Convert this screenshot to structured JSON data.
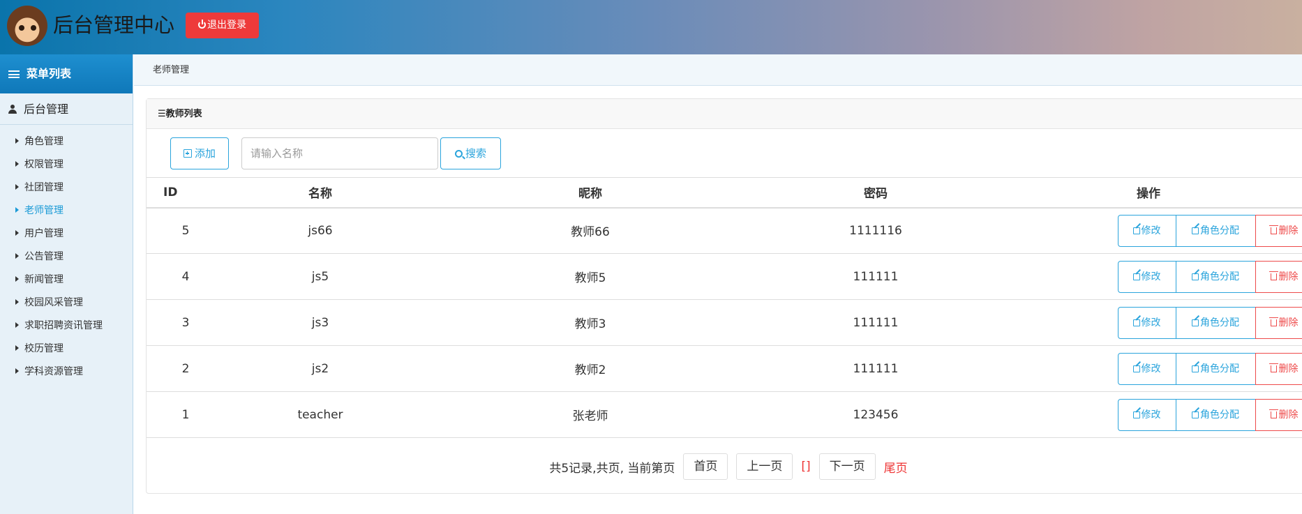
{
  "header": {
    "site_title": "后台管理中心",
    "logout_label": "退出登录",
    "accent_color": "#ee3a3a"
  },
  "sidebar": {
    "menu_title": "菜单列表",
    "group_title": "后台管理",
    "items": [
      {
        "label": "角色管理",
        "active": false
      },
      {
        "label": "权限管理",
        "active": false
      },
      {
        "label": "社团管理",
        "active": false
      },
      {
        "label": "老师管理",
        "active": true
      },
      {
        "label": "用户管理",
        "active": false
      },
      {
        "label": "公告管理",
        "active": false
      },
      {
        "label": "新闻管理",
        "active": false
      },
      {
        "label": "校园风采管理",
        "active": false
      },
      {
        "label": "求职招聘资讯管理",
        "active": false
      },
      {
        "label": "校历管理",
        "active": false
      },
      {
        "label": "学科资源管理",
        "active": false
      }
    ]
  },
  "breadcrumb": "老师管理",
  "panel": {
    "title": "☰教师列表",
    "add_label": "添加",
    "search_placeholder": "请输入名称",
    "search_label": "搜索"
  },
  "table": {
    "headers": {
      "id": "ID",
      "name": "名称",
      "nick": "昵称",
      "pwd": "密码",
      "ops": "操作"
    },
    "rows": [
      {
        "id": "5",
        "name": "js66",
        "nick": "教师66",
        "pwd": "1111116"
      },
      {
        "id": "4",
        "name": "js5",
        "nick": "教师5",
        "pwd": "111111"
      },
      {
        "id": "3",
        "name": "js3",
        "nick": "教师3",
        "pwd": "111111"
      },
      {
        "id": "2",
        "name": "js2",
        "nick": "教师2",
        "pwd": "111111"
      },
      {
        "id": "1",
        "name": "teacher",
        "nick": "张老师",
        "pwd": "123456"
      }
    ],
    "ops": {
      "edit": "修改",
      "role": "角色分配",
      "delete": "删除"
    }
  },
  "pager": {
    "summary": "共5记录,共页, 当前第页",
    "first": "首页",
    "prev": "上一页",
    "current": "[]",
    "next": "下一页",
    "last": "尾页"
  }
}
